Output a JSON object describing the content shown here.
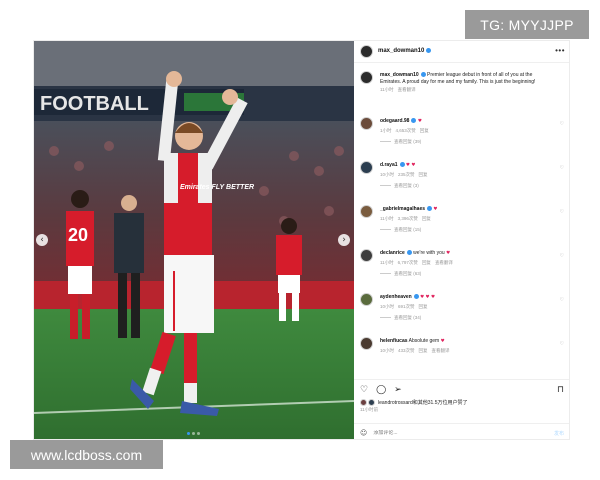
{
  "watermarks": {
    "top": "TG: MYYJJPP",
    "bottom": "www.lcdboss.com"
  },
  "photo": {
    "board_text": "FOOTBALL",
    "jersey_text": "Emirates FLY BETTER",
    "player_number": "20"
  },
  "header": {
    "username": "max_dowman10",
    "more_icon": "more-horizontal-icon"
  },
  "caption": {
    "username": "max_dowman10",
    "text": " Premier league debut in front of all of you at the Emirates. A proud day for me and my family. This is just the beginning!",
    "time": "11小时",
    "translate": "查看翻译"
  },
  "comments": [
    {
      "username": "odegaard.98",
      "text": "",
      "emoji": "♥",
      "time": "1小时",
      "likes": "4,653次赞",
      "reply": "回复",
      "replies": "查看回复 (39)"
    },
    {
      "username": "d.raya1",
      "text": "",
      "emoji": "♥ ♥",
      "time": "10小时",
      "likes": "235次赞",
      "reply": "回复",
      "replies": "查看回复 (3)"
    },
    {
      "username": "_gabrielmagalhaes",
      "text": "",
      "emoji": "♥",
      "time": "11小时",
      "likes": "3,396次赞",
      "reply": "回复",
      "replies": "查看回复 (15)"
    },
    {
      "username": "declanrice",
      "text": " we're with you ",
      "emoji": "♥",
      "time": "11小时",
      "likes": "6,797次赞",
      "reply": "回复",
      "translate": "查看翻译",
      "replies": "查看回复 (63)"
    },
    {
      "username": "aydenheaven",
      "text": "",
      "emoji": "♥ ♥ ♥",
      "time": "10小时",
      "likes": "691次赞",
      "reply": "回复",
      "replies": "查看回复 (34)"
    },
    {
      "username": "helenfiucas",
      "text": " Absolute gem ",
      "emoji": "♥",
      "time": "10小时",
      "likes": "433次赞",
      "reply": "回复",
      "translate": "查看翻译",
      "replies": ""
    }
  ],
  "actions": {
    "like_icon": "heart-icon",
    "comment_icon": "comment-icon",
    "share_icon": "send-icon",
    "save_icon": "bookmark-icon"
  },
  "likes": {
    "text": "leandrotrossard和其他31.5万位用户赞了"
  },
  "post_time": "11小时前",
  "add_comment": {
    "placeholder": "添加评论...",
    "post_label": "发布"
  },
  "colors": {
    "accent": "#3897f0",
    "arsenal_red": "#d61c2b",
    "pitch": "#3a7d3a"
  }
}
